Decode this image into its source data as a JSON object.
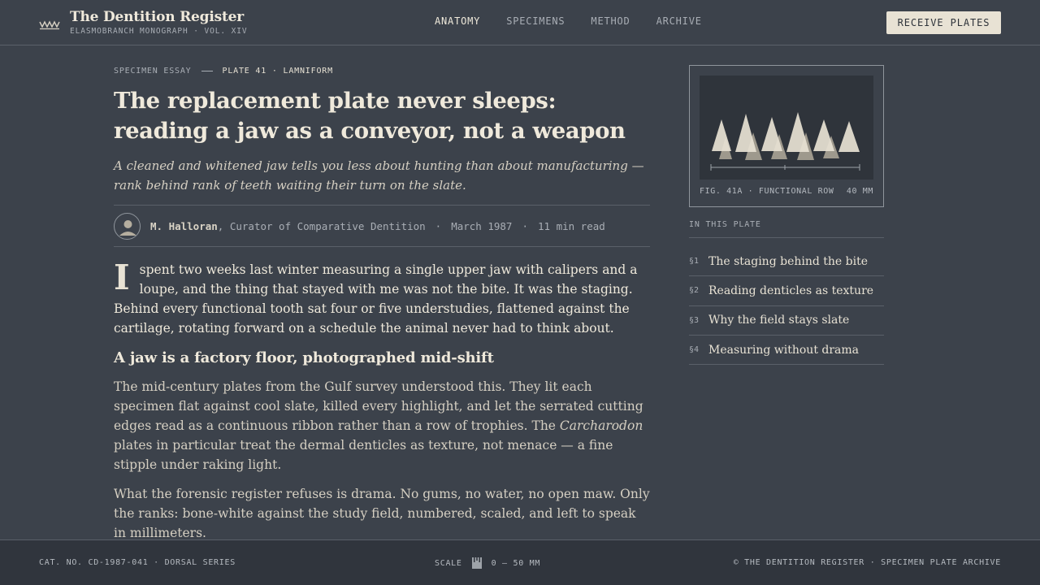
{
  "header": {
    "title": "The Dentition Register",
    "subtitle": "ELASMOBRANCH MONOGRAPH · VOL. XIV",
    "logo_icon": "jaw-teeth-icon",
    "nav": [
      {
        "label": "ANATOMY",
        "active": true
      },
      {
        "label": "SPECIMENS",
        "active": false
      },
      {
        "label": "METHOD",
        "active": false
      },
      {
        "label": "ARCHIVE",
        "active": false
      }
    ],
    "cta_label": "RECEIVE PLATES"
  },
  "article": {
    "kicker_section": "SPECIMEN ESSAY",
    "kicker_plate": "PLATE 41 · LAMNIFORM",
    "headline": "The replacement plate never sleeps: reading a jaw as a conveyor, not a weapon",
    "dek": "A cleaned and whitened jaw tells you less about hunting than about manufacturing — rank behind rank of teeth waiting their turn on the slate.",
    "byline": {
      "author": "M. Halloran",
      "role": ", Curator of Comparative Dentition",
      "date": "March 1987",
      "read_time": "11 min read",
      "avatar_icon": "person-icon"
    },
    "lead_dropcap": "I",
    "lead_text": "spent two weeks last winter measuring a single upper jaw with calipers and a loupe, and the thing that stayed with me was not the bite. It was the staging. Behind every functional tooth sat four or five understudies, flattened against the cartilage, rotating forward on a schedule the animal never had to think about.",
    "subhead": "A jaw is a factory floor, photographed mid-shift",
    "para1_a": "The mid-century plates from the Gulf survey understood this. They lit each specimen flat against cool slate, killed every highlight, and let the serrated cutting edges read as a continuous ribbon rather than a row of trophies. The ",
    "para1_em": "Carcharodon",
    "para1_b": " plates in particular treat the dermal denticles as texture, not menace — a fine stipple under raking light.",
    "para2": "What the forensic register refuses is drama. No gums, no water, no open maw. Only the ranks: bone-white against the study field, numbered, scaled, and left to speak in millimeters."
  },
  "sidebar": {
    "figure": {
      "caption": "FIG. 41A · FUNCTIONAL ROW",
      "scale": "40 MM"
    },
    "toc_label": "IN THIS PLATE",
    "toc": [
      {
        "num": "§1",
        "title": "The staging behind the bite"
      },
      {
        "num": "§2",
        "title": "Reading denticles as texture"
      },
      {
        "num": "§3",
        "title": "Why the field stays slate"
      },
      {
        "num": "§4",
        "title": "Measuring without drama"
      }
    ]
  },
  "footer": {
    "catalog": "CAT. NO. CD-1987-041 · DORSAL SERIES",
    "scale_label": "SCALE",
    "scale_icon": "scale-ruler-icon",
    "scale_range": "0 — 50 MM",
    "copyright": "© THE DENTITION REGISTER · SPECIMEN PLATE ARCHIVE"
  },
  "colors": {
    "background": "#3c424b",
    "text": "#efe9db",
    "accent_button": "#e8e2d4",
    "footer": "#30353d"
  }
}
